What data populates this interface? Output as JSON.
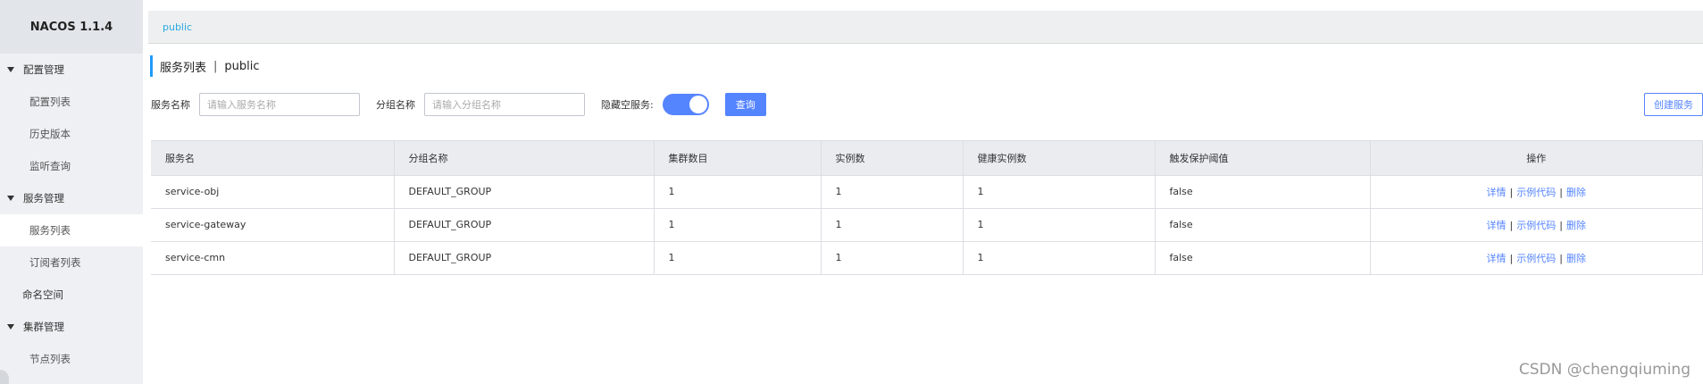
{
  "brand": "NACOS 1.1.4",
  "sidebar": {
    "groups": [
      {
        "label": "配置管理",
        "items": [
          "配置列表",
          "历史版本",
          "监听查询"
        ]
      },
      {
        "label": "服务管理",
        "items": [
          "服务列表",
          "订阅者列表"
        ]
      },
      {
        "label": "命名空间"
      },
      {
        "label": "集群管理",
        "items": [
          "节点列表"
        ]
      }
    ],
    "active": "服务列表"
  },
  "topbar": {
    "namespace": "public"
  },
  "page": {
    "title": "服务列表",
    "separator": "|",
    "namespace": "public"
  },
  "filters": {
    "service_label": "服务名称",
    "service_placeholder": "请输入服务名称",
    "group_label": "分组名称",
    "group_placeholder": "请输入分组名称",
    "hide_empty_label": "隐藏空服务:",
    "hide_empty_on": true,
    "query_button": "查询",
    "create_button": "创建服务"
  },
  "table": {
    "headers": [
      "服务名",
      "分组名称",
      "集群数目",
      "实例数",
      "健康实例数",
      "触发保护阈值",
      "操作"
    ],
    "rows": [
      {
        "name": "service-obj",
        "group": "DEFAULT_GROUP",
        "clusters": "1",
        "instances": "1",
        "healthy": "1",
        "threshold": "false"
      },
      {
        "name": "service-gateway",
        "group": "DEFAULT_GROUP",
        "clusters": "1",
        "instances": "1",
        "healthy": "1",
        "threshold": "false"
      },
      {
        "name": "service-cmn",
        "group": "DEFAULT_GROUP",
        "clusters": "1",
        "instances": "1",
        "healthy": "1",
        "threshold": "false"
      }
    ],
    "actions": {
      "detail": "详情",
      "sample": "示例代码",
      "delete": "删除",
      "sep": "|"
    }
  },
  "watermark": "CSDN @chengqiuming"
}
